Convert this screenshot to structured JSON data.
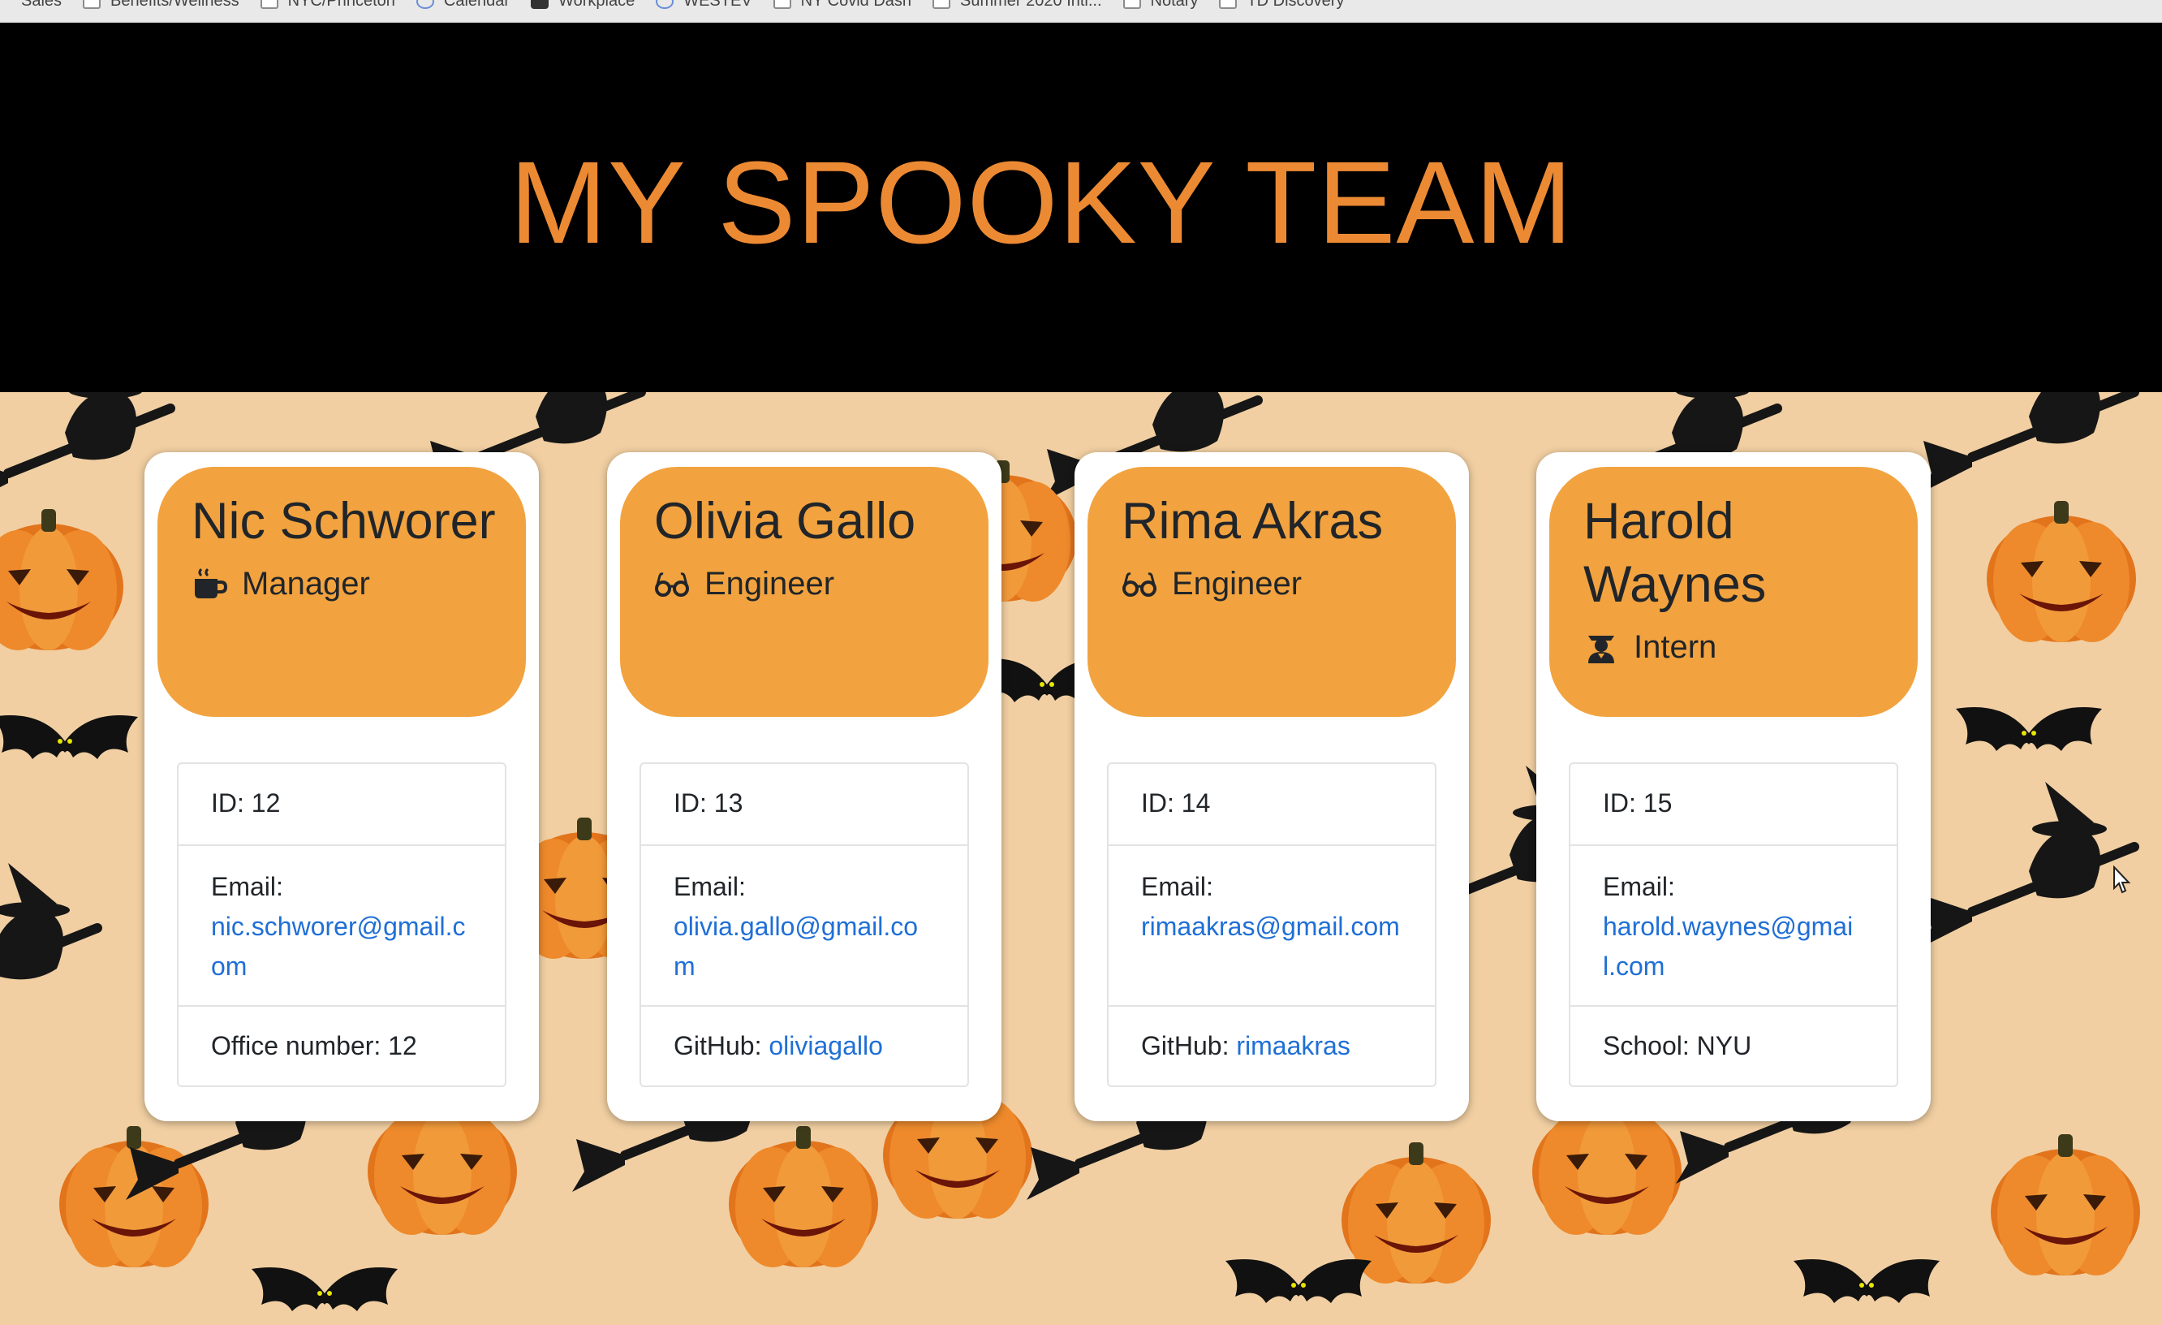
{
  "bookmarks": [
    "Sales",
    "Benefits/Wellness",
    "NYC/Princeton",
    "Calendar",
    "Workplace",
    "WESTEV",
    "NY Covid Dash",
    "Summer 2020 Intl...",
    "Notary",
    "TD Discovery"
  ],
  "header": {
    "title": "MY SPOOKY TEAM"
  },
  "colors": {
    "title": "#ec8a33",
    "card_header": "#f2a33f",
    "link": "#1f6fd6",
    "background": "#f1cfa2"
  },
  "team": [
    {
      "name": "Nic Schworer",
      "role": "Manager",
      "role_icon": "coffee-mug-icon",
      "id_label": "ID: 12",
      "email_label": "Email:",
      "email": "nic.schworer@gmail.com",
      "extra_label": "Office number: 12",
      "extra_link": ""
    },
    {
      "name": "Olivia Gallo",
      "role": "Engineer",
      "role_icon": "glasses-icon",
      "id_label": "ID: 13",
      "email_label": "Email:",
      "email": "olivia.gallo@gmail.com",
      "extra_label": "GitHub: ",
      "extra_link": "oliviagallo"
    },
    {
      "name": "Rima Akras",
      "role": "Engineer",
      "role_icon": "glasses-icon",
      "id_label": "ID: 14",
      "email_label": "Email:",
      "email": "rimaakras@gmail.com",
      "extra_label": "GitHub: ",
      "extra_link": "rimaakras"
    },
    {
      "name": "Harold Waynes",
      "role": "Intern",
      "role_icon": "graduate-icon",
      "id_label": "ID: 15",
      "email_label": "Email:",
      "email": "harold.waynes@gmail.com",
      "extra_label": "School: NYU",
      "extra_link": ""
    }
  ]
}
